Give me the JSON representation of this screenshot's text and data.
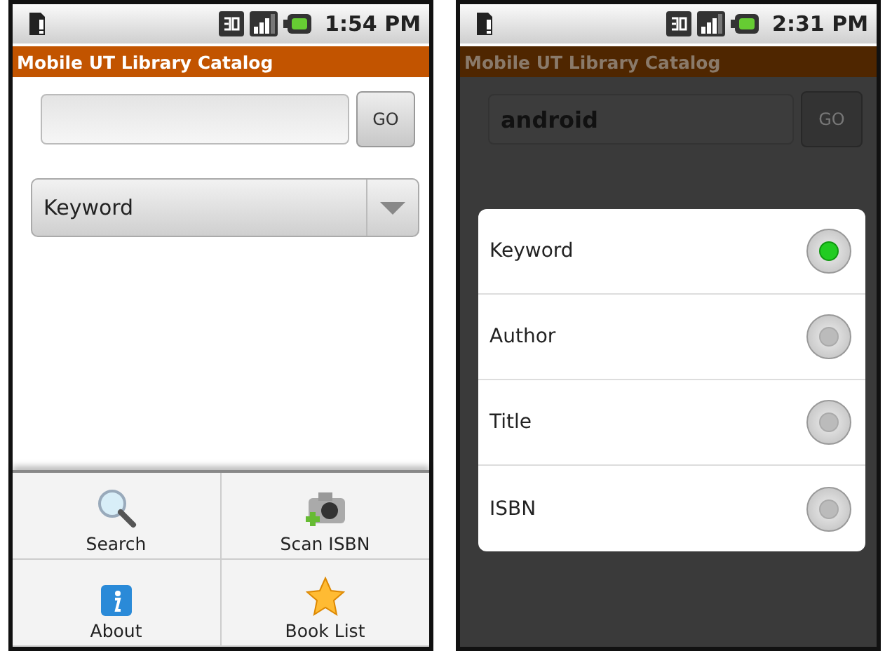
{
  "left_screen": {
    "status_bar": {
      "time": "1:54 PM"
    },
    "app_title": "Mobile UT Library Catalog",
    "go_button": "GO",
    "search_type": "Keyword",
    "menu": [
      {
        "label": "Search",
        "kind": "search"
      },
      {
        "label": "Scan ISBN",
        "kind": "camera"
      },
      {
        "label": "About",
        "kind": "info"
      },
      {
        "label": "Book List",
        "kind": "star"
      }
    ]
  },
  "right_screen": {
    "status_bar": {
      "time": "2:31 PM"
    },
    "app_title": "Mobile UT Library Catalog",
    "search": {
      "value": "android"
    },
    "go_button": "GO",
    "options": [
      {
        "label": "Keyword",
        "selected": true
      },
      {
        "label": "Author",
        "selected": false
      },
      {
        "label": "Title",
        "selected": false
      },
      {
        "label": "ISBN",
        "selected": false
      }
    ]
  }
}
